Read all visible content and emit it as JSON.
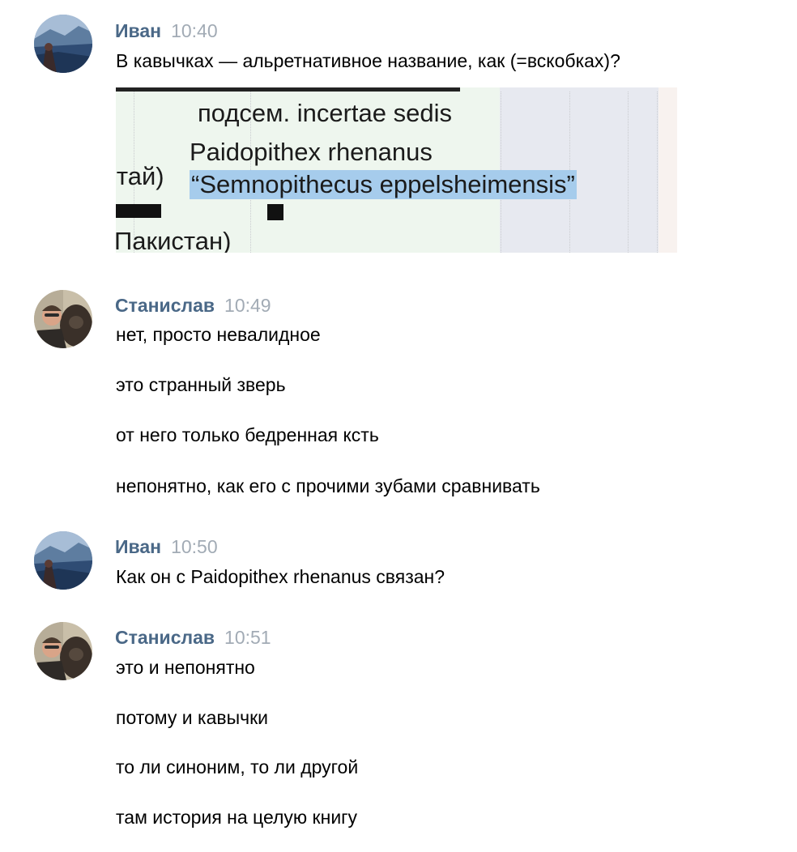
{
  "messages": [
    {
      "author": "Иван",
      "time": "10:40",
      "lines": [
        "В кавычках — альретнативное название, как (=вскобках)?"
      ],
      "attachment": {
        "subfamily": "подсем. incertae sedis",
        "species": "Paidopithex rhenanus",
        "synonym": "“Semnopithecus eppelsheimensis”",
        "left_fragment_1": "ітай)",
        "left_fragment_2": "Пакистан)"
      }
    },
    {
      "author": "Станислав",
      "time": "10:49",
      "lines": [
        "нет, просто невалидное",
        "это странный зверь",
        "от него только бедренная ксть",
        "непонятно, как его с прочими зубами сравнивать"
      ]
    },
    {
      "author": "Иван",
      "time": "10:50",
      "lines": [
        "Как он с Paidopithex rhenanus связан?"
      ]
    },
    {
      "author": "Станислав",
      "time": "10:51",
      "lines": [
        "это и непонятно",
        "потому и кавычки",
        "то ли синоним, то ли другой",
        "там история на целую книгу"
      ]
    }
  ],
  "colors": {
    "author": "#4a6887",
    "time": "#a2abb5",
    "text": "#000000",
    "highlight": "#a6ccec"
  },
  "icons": {
    "ivan_avatar": "landscape-photo-avatar",
    "stanislav_avatar": "person-with-gorilla-photo-avatar"
  }
}
